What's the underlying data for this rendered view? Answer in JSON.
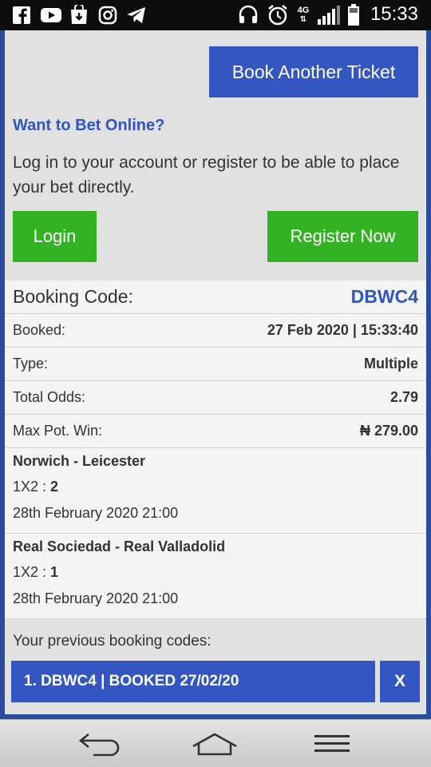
{
  "status_bar": {
    "time": "15:33",
    "network": "4G",
    "icons": [
      "facebook-icon",
      "youtube-icon",
      "download-store-icon",
      "instagram-icon",
      "telegram-icon",
      "headset-icon",
      "alarm-icon",
      "signal-icon",
      "battery-icon"
    ]
  },
  "actions": {
    "book_another": "Book Another Ticket",
    "want_to_bet": "Want to Bet Online?",
    "description": "Log in to your account or register to be able to place your bet directly.",
    "login": "Login",
    "register": "Register Now"
  },
  "booking": {
    "code_label": "Booking Code:",
    "code_value": "DBWC4",
    "rows": [
      {
        "label": "Booked:",
        "value": "27 Feb 2020 | 15:33:40"
      },
      {
        "label": "Type:",
        "value": "Multiple"
      },
      {
        "label": "Total Odds:",
        "value": "2.79"
      },
      {
        "label": "Max Pot. Win:",
        "value": "₦ 279.00"
      }
    ],
    "matches": [
      {
        "teams": "Norwich - Leicester",
        "market": "1X2 :",
        "pick": "2",
        "date": "28th February 2020 21:00"
      },
      {
        "teams": "Real Sociedad - Real Valladolid",
        "market": "1X2 :",
        "pick": "1",
        "date": "28th February 2020 21:00"
      }
    ]
  },
  "previous": {
    "label": "Your previous booking codes:",
    "items": [
      {
        "text": "1. DBWC4 | BOOKED 27/02/20",
        "close": "X"
      }
    ]
  },
  "colors": {
    "primary_blue": "#3356c2",
    "green": "#33b323",
    "frame_blue": "#2b4c9a"
  }
}
